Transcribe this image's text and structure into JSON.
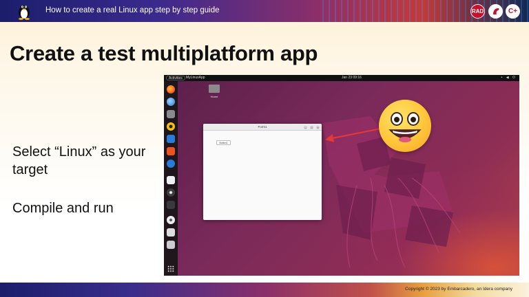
{
  "banner": {
    "title": "How to create a real Linux app step by step guide",
    "logos": [
      {
        "name": "rad-studio-logo",
        "text": "RAD"
      },
      {
        "name": "delphi-logo",
        "text": ""
      },
      {
        "name": "cpp-builder-logo",
        "text": "C+"
      }
    ]
  },
  "slide": {
    "title": "Create a test multiplatform app",
    "bullets": [
      "Select “Linux” as your target",
      "Compile and run"
    ]
  },
  "desktop": {
    "topbar": {
      "activities": "Activities",
      "app_name": "MyLinuxApp",
      "clock": "Jan 23  09:16",
      "tray": "• ◀ ⏻"
    },
    "desktop_folder_label": "Home",
    "window": {
      "title": "Form1",
      "button_label": "Button1"
    }
  },
  "footer": {
    "copyright": "Copyright © 2023  by Embarcadero, an Idera company"
  },
  "colors": {
    "accent_red": "#c8102e",
    "ubuntu_purple": "#7a2a5a",
    "arrow_red": "#e53935"
  }
}
